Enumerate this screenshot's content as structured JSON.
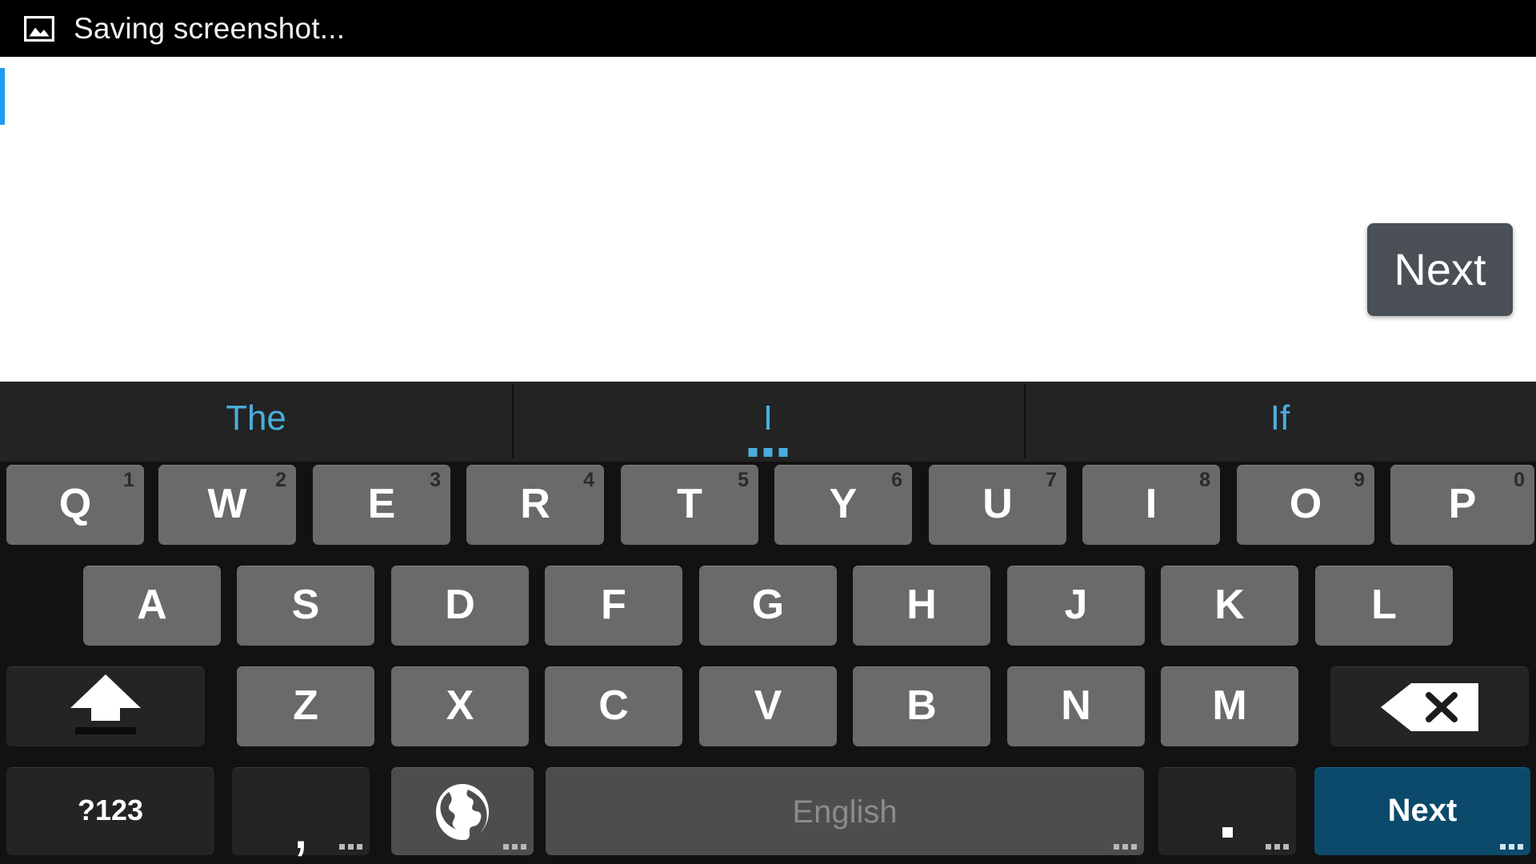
{
  "status_bar": {
    "icon": "image-icon",
    "text": "Saving screenshot..."
  },
  "content": {
    "caret": "text-cursor",
    "key_preview": {
      "label": "Next"
    }
  },
  "keyboard": {
    "suggestions": [
      {
        "label": "The",
        "has_more_dots": false
      },
      {
        "label": "I",
        "has_more_dots": true
      },
      {
        "label": "If",
        "has_more_dots": false
      }
    ],
    "row1": [
      {
        "label": "Q",
        "hint": "1"
      },
      {
        "label": "W",
        "hint": "2"
      },
      {
        "label": "E",
        "hint": "3"
      },
      {
        "label": "R",
        "hint": "4"
      },
      {
        "label": "T",
        "hint": "5"
      },
      {
        "label": "Y",
        "hint": "6"
      },
      {
        "label": "U",
        "hint": "7"
      },
      {
        "label": "I",
        "hint": "8"
      },
      {
        "label": "O",
        "hint": "9"
      },
      {
        "label": "P",
        "hint": "0"
      }
    ],
    "row2": [
      {
        "label": "A"
      },
      {
        "label": "S"
      },
      {
        "label": "D"
      },
      {
        "label": "F"
      },
      {
        "label": "G"
      },
      {
        "label": "H"
      },
      {
        "label": "J"
      },
      {
        "label": "K"
      },
      {
        "label": "L"
      }
    ],
    "row3": {
      "shift": "shift-key",
      "letters": [
        {
          "label": "Z"
        },
        {
          "label": "X"
        },
        {
          "label": "C"
        },
        {
          "label": "V"
        },
        {
          "label": "B"
        },
        {
          "label": "N"
        },
        {
          "label": "M"
        }
      ],
      "backspace": "backspace-key"
    },
    "row4": {
      "symbols_label": "?123",
      "comma_label": ",",
      "language_icon": "globe-icon",
      "space_label": "English",
      "period_label": ".",
      "action_label": "Next"
    }
  },
  "colors": {
    "status_bar_bg": "#000000",
    "content_bg": "#ffffff",
    "caret": "#1e9cf0",
    "keyboard_bg": "#121212",
    "suggestion_strip_bg": "#232323",
    "suggestion_text": "#4aaedd",
    "letter_key": "#6a6a6a",
    "dark_key": "#242424",
    "mid_key": "#4d4d4d",
    "action_key": "#0c4a6b",
    "key_preview_bg": "#4b5057",
    "space_label": "#8b8b8b",
    "hint_num": "#2b2b2b"
  }
}
